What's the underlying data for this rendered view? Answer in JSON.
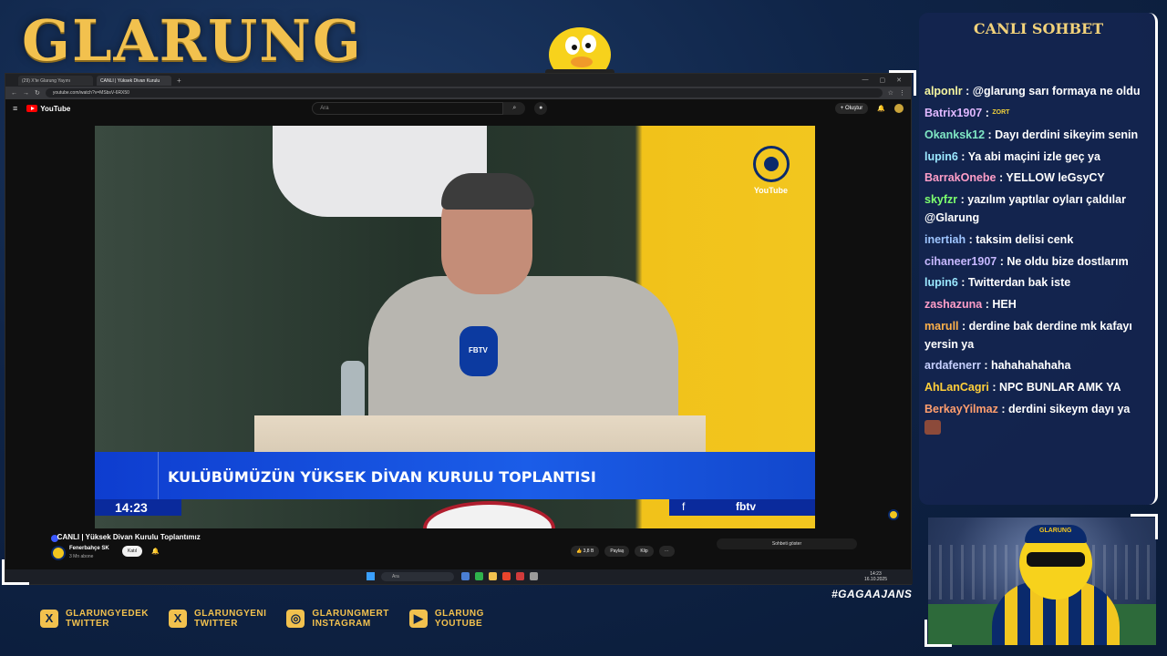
{
  "brand": {
    "title": "GLARUNG"
  },
  "browser": {
    "tabs": [
      {
        "label": "(29) X'te Glarung Yayını"
      },
      {
        "label": "CANLI | Yüksek Divan Kurulu"
      }
    ],
    "url": "youtube.com/watch?v=MSbsV-6RX50"
  },
  "youtube": {
    "search_placeholder": "Ara",
    "create_label": "Oluştur",
    "logo_text": "YouTube",
    "video": {
      "lower_third": "KULÜBÜMÜZÜN YÜKSEK DİVAN KURULU TOPLANTISI",
      "clock": "14:23",
      "fbtv_label": "fbtv",
      "fb_yt_label": "YouTube",
      "mic_label": "FBTV"
    },
    "title": "CANLI | Yüksek Divan Kurulu Toplantımız",
    "channel": "Fenerbahçe SK",
    "subs": "3 Mn abone",
    "join_label": "Katıl",
    "likes": "3,8 B",
    "share_label": "Paylaş",
    "clip_label": "Klip",
    "chat_show_label": "Sohbeti göster"
  },
  "taskbar": {
    "search_placeholder": "Ara",
    "time": "14:23",
    "date": "16.10.2025"
  },
  "socials": [
    {
      "icon": "x-icon",
      "line1": "GLARUNGYEDEK",
      "line2": "TWITTER"
    },
    {
      "icon": "x-icon",
      "line1": "GLARUNGYENI",
      "line2": "TWITTER"
    },
    {
      "icon": "instagram-icon",
      "line1": "GLARUNGMERT",
      "line2": "INSTAGRAM"
    },
    {
      "icon": "youtube-icon",
      "line1": "GLARUNG",
      "line2": "YOUTUBE"
    }
  ],
  "hashtag": "#GAGAAJANS",
  "chat": {
    "title": "CANLI SOHBET",
    "messages": [
      {
        "user": "alponlr",
        "color": "#f5f5a0",
        "text": " : @glarung sarı formaya ne oldu"
      },
      {
        "user": "Batrix1907",
        "color": "#e0b8ff",
        "text": " : ",
        "emote": "ZORT"
      },
      {
        "user": "Okanksk12",
        "color": "#7fe7c4",
        "text": " : Dayı derdini sikeyim senin"
      },
      {
        "user": "lupin6",
        "color": "#9be8ff",
        "text": " : Ya abi maçini izle geç ya"
      },
      {
        "user": "BarrakOnebe",
        "color": "#ff9ec8",
        "text": " : YELLOW leGsyCY"
      },
      {
        "user": "skyfzr",
        "color": "#7dff6e",
        "text": " : yazılım yaptılar oyları çaldılar @Glarung"
      },
      {
        "user": "inertiah",
        "color": "#9ec5ff",
        "text": " : taksim delisi cenk"
      },
      {
        "user": "cihaneer1907",
        "color": "#c7b8ff",
        "text": " : Ne oldu bize dostlarım"
      },
      {
        "user": "lupin6",
        "color": "#9be8ff",
        "text": " : Twitterdan bak iste"
      },
      {
        "user": "zashazuna",
        "color": "#ff9ec8",
        "text": " : HEH"
      },
      {
        "user": "marull",
        "color": "#ffb14a",
        "text": " : derdine bak derdine mk kafayı yersin ya"
      },
      {
        "user": "ardafenerr",
        "color": "#c7d0ff",
        "text": " : hahahahahaha"
      },
      {
        "user": "AhLanCagri",
        "color": "#ffcf3a",
        "text": " : NPC BUNLAR AMK YA"
      },
      {
        "user": "BerkayYilmaz",
        "color": "#ff9e6e",
        "text": " : derdini sikeym dayı ya"
      }
    ]
  },
  "webcam": {
    "hat_label": "GLARUNG"
  }
}
